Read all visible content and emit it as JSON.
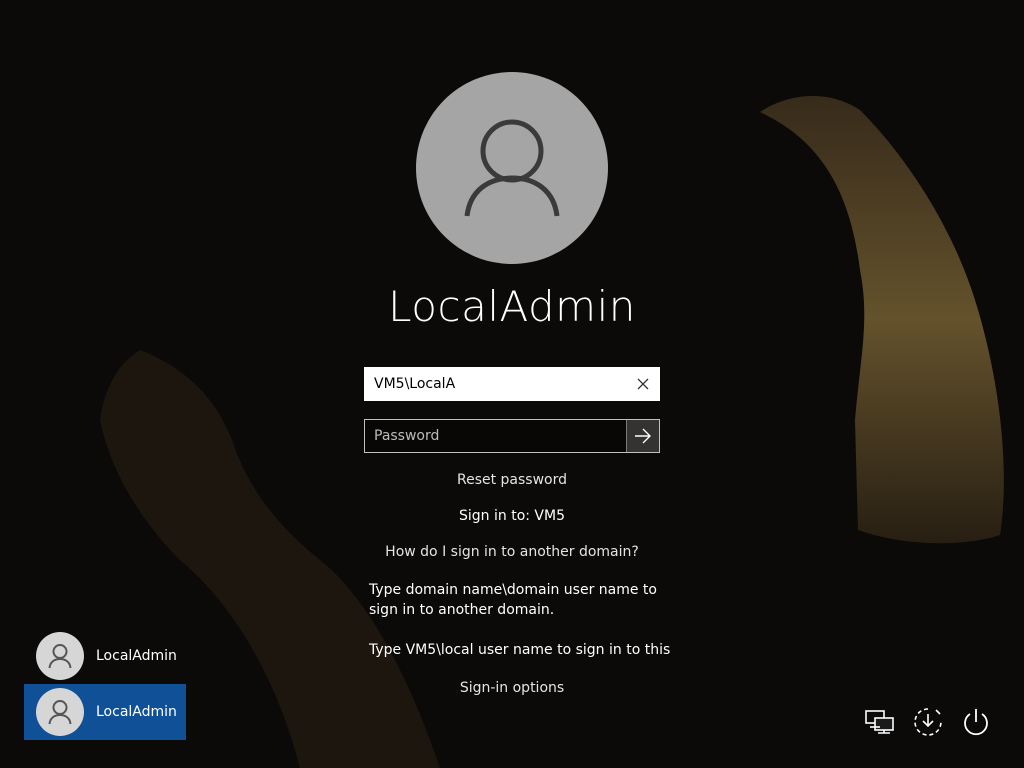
{
  "account": {
    "display_name": "LocalAdmin"
  },
  "sign_in": {
    "username_value": "VM5\\LocalA",
    "password_placeholder": "Password",
    "reset_password_label": "Reset password",
    "sign_in_to_label": "Sign in to: VM5",
    "other_domain_link": "How do I sign in to another domain?",
    "help_line_1": "Type domain name\\domain user name to sign in to another domain.",
    "help_line_2": "Type VM5\\local user name to sign in to this",
    "sign_in_options_label": "Sign-in options"
  },
  "user_tiles": [
    {
      "label": "LocalAdmin",
      "selected": false
    },
    {
      "label": "LocalAdmin",
      "selected": true
    }
  ],
  "system_icons": [
    "network-icon",
    "ease-of-access-icon",
    "power-icon"
  ],
  "colors": {
    "selected_tile": "#0f5096",
    "text": "#ffffff"
  }
}
